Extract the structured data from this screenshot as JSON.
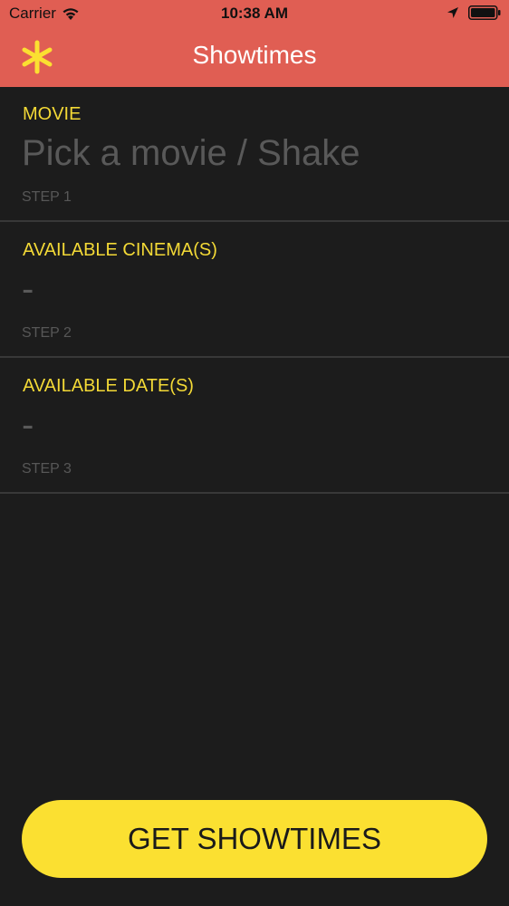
{
  "status_bar": {
    "carrier": "Carrier",
    "time": "10:38 AM"
  },
  "nav": {
    "title": "Showtimes",
    "logo_icon": "asterisk-icon"
  },
  "sections": [
    {
      "label": "MOVIE",
      "value": "Pick a movie / Shake",
      "step": "STEP 1"
    },
    {
      "label": "AVAILABLE CINEMA(S)",
      "value": "-",
      "step": "STEP 2"
    },
    {
      "label": "AVAILABLE DATE(S)",
      "value": "-",
      "step": "STEP 3"
    }
  ],
  "cta": {
    "label": "GET SHOWTIMES"
  },
  "colors": {
    "header": "#e05e53",
    "accent": "#f3d936",
    "background": "#1c1c1c",
    "button": "#fbe031"
  }
}
